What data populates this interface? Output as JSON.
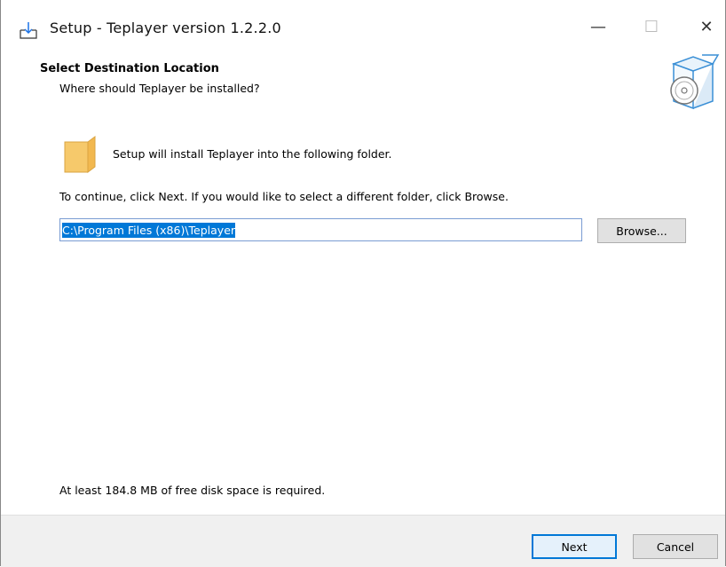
{
  "window": {
    "title": "Setup - Teplayer version 1.2.2.0",
    "minimize_glyph": "—",
    "maximize_glyph": "☐",
    "close_glyph": "✕",
    "app_icon": "install-download-icon"
  },
  "header": {
    "title": "Select Destination Location",
    "subtitle": "Where should Teplayer be installed?",
    "icon": "software-box-disc-icon"
  },
  "body": {
    "folder_icon": "folder-icon",
    "intro": "Setup will install Teplayer into the following folder.",
    "instruction": "To continue, click Next. If you would like to select a different folder, click Browse.",
    "path_value": "C:\\Program Files (x86)\\Teplayer",
    "browse_label": "Browse...",
    "disk_space": "At least 184.8 MB of free disk space is required."
  },
  "footer": {
    "next_label": "Next",
    "cancel_label": "Cancel"
  },
  "colors": {
    "selection": "#0078d7",
    "footer_bg": "#f0f0f0",
    "folder": "#f6c96b"
  }
}
